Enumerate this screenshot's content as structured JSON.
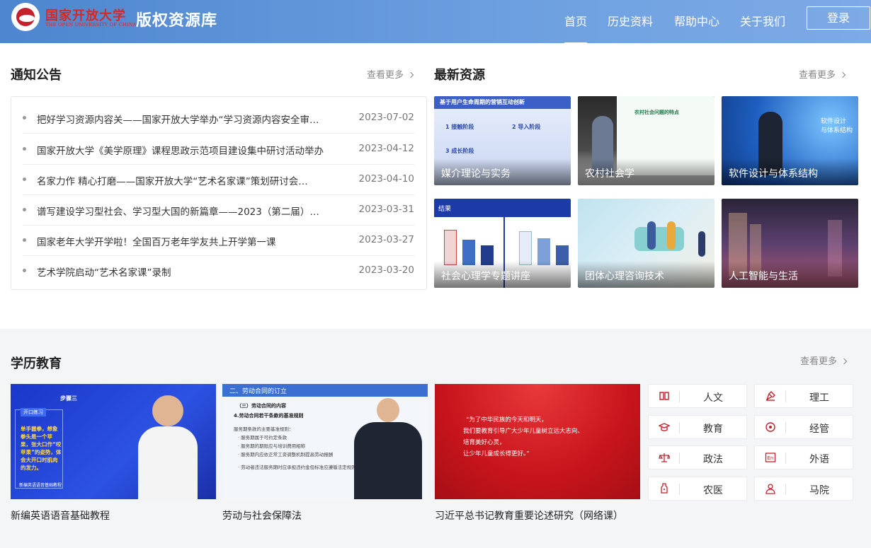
{
  "header": {
    "brand_cn": "国家开放大学",
    "brand_en": "THE OPEN UNIVERSITY OF CHINA",
    "site_name": "版权资源库",
    "nav": [
      "首页",
      "历史资料",
      "帮助中心",
      "关于我们"
    ],
    "active_nav": "首页",
    "login_label": "登录"
  },
  "notices": {
    "title": "通知公告",
    "more": "查看更多",
    "items": [
      {
        "text": "把好学习资源内容关——国家开放大学举办“学习资源内容安全审…",
        "date": "2023-07-02"
      },
      {
        "text": "国家开放大学《美学原理》课程思政示范项目建设集中研讨活动举办",
        "date": "2023-04-12"
      },
      {
        "text": "名家力作 精心打磨——国家开放大学“艺术名家课”策划研讨会…",
        "date": "2023-04-10"
      },
      {
        "text": "谱写建设学习型社会、学习型大国的新篇章——2023（第二届）…",
        "date": "2023-03-31"
      },
      {
        "text": "国家老年大学开学啦！全国百万老年学友共上开学第一课",
        "date": "2023-03-27"
      },
      {
        "text": "艺术学院启动“艺术名家课”录制",
        "date": "2023-03-20"
      }
    ]
  },
  "resources": {
    "title": "最新资源",
    "more": "查看更多",
    "items": [
      {
        "title": "媒介理论与实务",
        "thumb_lines": [
          "基于用户生命周期的营销互动创新",
          "1 接触阶段",
          "2 导入阶段",
          "3 成长阶段"
        ]
      },
      {
        "title": "农村社会学",
        "thumb_lines": [
          "农村社会问题的特点"
        ]
      },
      {
        "title": "软件设计与体系结构",
        "thumb_lines": [
          "软件设计",
          "与体系结构"
        ]
      },
      {
        "title": "社会心理学专题讲座",
        "thumb_lines": [
          "结果"
        ]
      },
      {
        "title": "团体心理咨询技术",
        "thumb_lines": []
      },
      {
        "title": "人工智能与生活",
        "thumb_lines": []
      }
    ]
  },
  "education": {
    "title": "学历教育",
    "more": "查看更多",
    "courses": [
      {
        "title": "新编英语语音基础教程",
        "thumb_lines": [
          "开口练习",
          "步骤三",
          "单手握拳，想象拳头是一个苹果，张大口作“咬苹果”的姿势，体会大开口时肌肉的发力。",
          "新编英语语音基础教程"
        ]
      },
      {
        "title": "劳动与社会保障法",
        "thumb_lines": [
          "二、劳动合同的订立",
          "（三）劳动合同的内容",
          "4.劳动合同若干条款的基准规则",
          "服务期条款的主要基准规则：",
          "· 服务期属于可约定条款",
          "· 服务期的期限应与培训费用相称",
          "· 服务期内应依正常工资调整机制提高劳动报酬",
          "· 劳动者违法服务期时应承担违约金但标准应遵循法定规则"
        ]
      },
      {
        "title": "习近平总书记教育重要论述研究（网络课）",
        "thumb_lines": [
          "“为了中华民族的今天和明天，",
          "我们要教育引导广大少年儿童树立远大志向、",
          "培育美好心灵，",
          "让少年儿童成长得更好。”"
        ]
      }
    ],
    "categories": [
      {
        "label": "人文",
        "icon": "book-icon"
      },
      {
        "label": "理工",
        "icon": "pen-tool-icon"
      },
      {
        "label": "教育",
        "icon": "graduation-cap-icon"
      },
      {
        "label": "经管",
        "icon": "target-icon"
      },
      {
        "label": "政法",
        "icon": "scales-icon"
      },
      {
        "label": "外语",
        "icon": "en-icon"
      },
      {
        "label": "农医",
        "icon": "bottle-icon"
      },
      {
        "label": "马院",
        "icon": "person-icon"
      }
    ]
  },
  "colors": {
    "header": "#5b93d8",
    "brand_red": "#c7202d",
    "text": "#333333"
  }
}
